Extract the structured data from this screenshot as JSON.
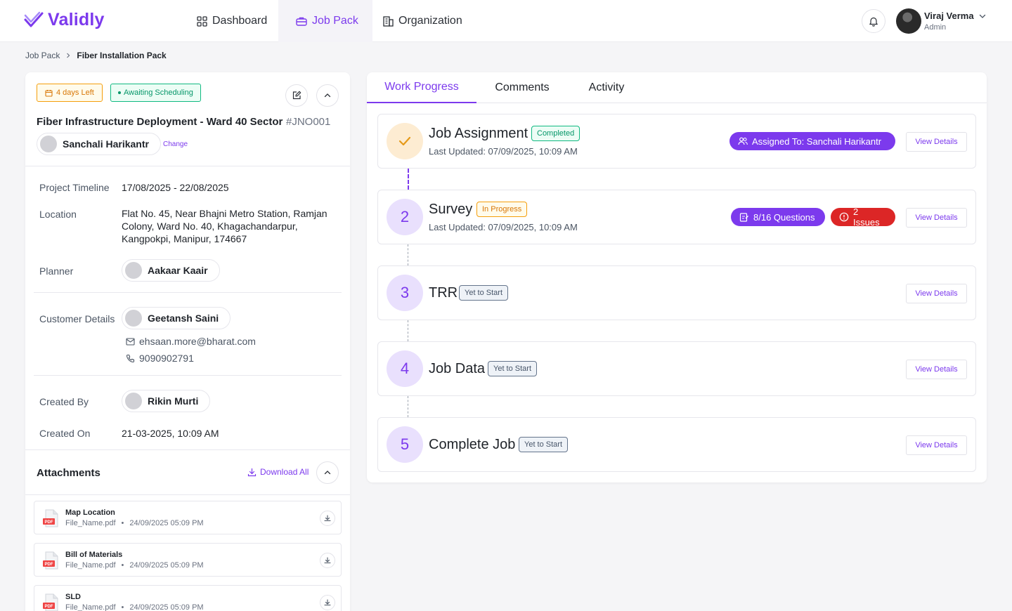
{
  "app": {
    "logo_text": "Validly",
    "brand_color": "#7c3aed"
  },
  "nav": {
    "dashboard": "Dashboard",
    "job_pack": "Job Pack",
    "organization": "Organization",
    "active": "Job Pack"
  },
  "user": {
    "name": "Viraj Verma",
    "role": "Admin"
  },
  "breadcrumb": {
    "parent": "Job Pack",
    "current": "Fiber Installation Pack"
  },
  "job": {
    "days_left": "4 days Left",
    "status": "Awaiting Scheduling",
    "title": "Fiber Infrastructure Deployment - Ward 40 Sector",
    "code": "#JNO001",
    "assignee": "Sanchali Harikantr",
    "change_label": "Change",
    "timeline_label": "Project Timeline",
    "timeline_value": "17/08/2025 - 22/08/2025",
    "location_label": "Location",
    "location_value": "Flat No. 45, Near Bhajni Metro Station, Ramjan Colony, Ward No. 40, Khagachandarpur, Kangpokpi, Manipur, 174667",
    "planner_label": "Planner",
    "planner_value": "Aakaar Kaair",
    "customer_label": "Customer Details",
    "customer_name": "Geetansh Saini",
    "customer_email": "ehsaan.more@bharat.com",
    "customer_phone": "9090902791",
    "created_by_label": "Created By",
    "created_by_value": "Rikin Murti",
    "created_on_label": "Created On",
    "created_on_value": "21-03-2025, 10:09 AM"
  },
  "attachments": {
    "title": "Attachments",
    "download_all": "Download All",
    "files": [
      {
        "title": "Map Location",
        "file": "File_Name.pdf",
        "date": "24/09/2025 05:09 PM"
      },
      {
        "title": "Bill of Materials",
        "file": "File_Name.pdf",
        "date": "24/09/2025 05:09 PM"
      },
      {
        "title": "SLD",
        "file": "File_Name.pdf",
        "date": "24/09/2025 05:09 PM"
      }
    ]
  },
  "tabs": [
    "Work Progress",
    "Comments",
    "Activity"
  ],
  "active_tab": "Work Progress",
  "steps": [
    {
      "number": "✓",
      "name": "Job Assignment",
      "status": "Completed",
      "updated": "Last Updated: 07/09/2025, 10:09 AM",
      "assigned": "Assigned To: Sanchali Harikantr",
      "view": "View Details"
    },
    {
      "number": "2",
      "name": "Survey",
      "status": "In Progress",
      "updated": "Last Updated: 07/09/2025, 10:09 AM",
      "questions": "8/16 Questions",
      "issues": "2 Issues",
      "view": "View Details"
    },
    {
      "number": "3",
      "name": "TRR",
      "status": "Yet to Start",
      "view": "View Details"
    },
    {
      "number": "4",
      "name": "Job Data",
      "status": "Yet to Start",
      "view": "View Details"
    },
    {
      "number": "5",
      "name": "Complete Job",
      "status": "Yet to Start",
      "view": "View Details"
    }
  ]
}
